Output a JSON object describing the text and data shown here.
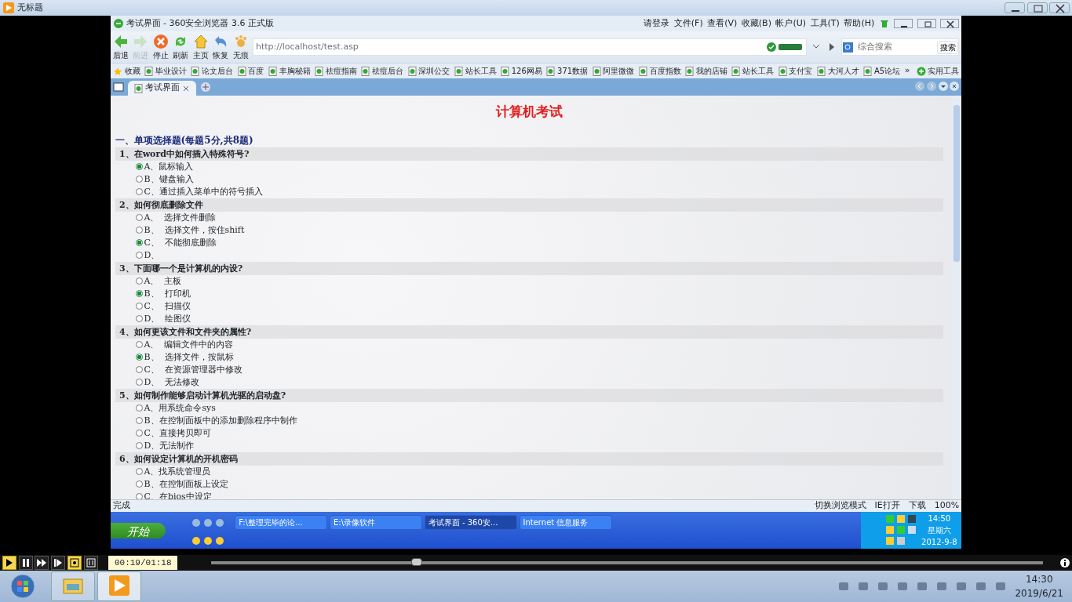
{
  "player_window": {
    "title": "无标题"
  },
  "browser": {
    "title": "考试界面 - 360安全浏览器 3.6 正式版",
    "menu": [
      "请登录",
      "文件(F)",
      "查看(V)",
      "收藏(B)",
      "帐户(U)",
      "工具(T)",
      "帮助(H)"
    ],
    "toolbar": [
      {
        "kind": "back",
        "label": "后退",
        "disabled": false
      },
      {
        "kind": "forward",
        "label": "前进",
        "disabled": true
      },
      {
        "kind": "stop",
        "label": "停止",
        "disabled": false
      },
      {
        "kind": "refresh",
        "label": "刷新",
        "disabled": false
      },
      {
        "kind": "home",
        "label": "主页",
        "disabled": false
      },
      {
        "kind": "restore",
        "label": "恢复",
        "disabled": false
      },
      {
        "kind": "private",
        "label": "无痕",
        "disabled": false
      }
    ],
    "address": "http://localhost/test.asp",
    "search": {
      "placeholder": "综合搜索",
      "button": "搜索"
    },
    "favorites": "收藏",
    "bookmarks": [
      "毕业设计",
      "论文后台",
      "百度",
      "丰胸秘籍",
      "祛痘指南",
      "祛痘后台",
      "深圳公交",
      "站长工具",
      "126网易",
      "371数据",
      "阿里微微",
      "百度指数",
      "我的店铺",
      "站长工具",
      "支付宝",
      "大河人才",
      "A5论坛"
    ],
    "more": "»",
    "tools": "实用工具",
    "tabs": [
      {
        "label": "考试界面",
        "selected": true
      }
    ]
  },
  "page": {
    "title": "计算机考试",
    "section": "一、单项选择题(每题5分,共8题)",
    "questions": [
      {
        "title": "1、在word中如何插入特殊符号?",
        "options": [
          {
            "text": "A、鼠标输入",
            "selected": true
          },
          {
            "text": "B、键盘输入",
            "selected": false
          },
          {
            "text": "C、通过插入菜单中的符号插入",
            "selected": false
          }
        ]
      },
      {
        "title": "2、如何彻底删除文件",
        "options": [
          {
            "text": "A、  选择文件删除",
            "selected": false
          },
          {
            "text": "B、  选择文件，按住shift",
            "selected": false
          },
          {
            "text": "C、  不能彻底删除",
            "selected": true
          },
          {
            "text": "D、",
            "selected": false
          }
        ]
      },
      {
        "title": "3、下面哪一个是计算机的内设?",
        "options": [
          {
            "text": "A、  主板",
            "selected": false
          },
          {
            "text": "B、  打印机",
            "selected": true
          },
          {
            "text": "C、  扫描仪",
            "selected": false
          },
          {
            "text": "D、  绘图仪",
            "selected": false
          }
        ]
      },
      {
        "title": "4、如何更该文件和文件夹的属性?",
        "options": [
          {
            "text": "A、  编辑文件中的内容",
            "selected": false
          },
          {
            "text": "B、  选择文件，按鼠标",
            "selected": true
          },
          {
            "text": "C、  在资源管理器中修改",
            "selected": false
          },
          {
            "text": "D、  无法修改",
            "selected": false
          }
        ]
      },
      {
        "title": "5、如何制作能够启动计算机光驱的启动盘?",
        "options": [
          {
            "text": "A、用系统命令sys",
            "selected": false
          },
          {
            "text": "B、在控制面板中的添加删除程序中制作",
            "selected": false
          },
          {
            "text": "C、直接拷贝即可",
            "selected": false
          },
          {
            "text": "D、无法制作",
            "selected": false
          }
        ]
      },
      {
        "title": "6、如何设定计算机的开机密码",
        "options": [
          {
            "text": "A、找系统管理员",
            "selected": false
          },
          {
            "text": "B、在控制面板上设定",
            "selected": false
          },
          {
            "text": "C、在bios中设定",
            "selected": false
          }
        ]
      }
    ]
  },
  "status_bar": {
    "text": "完成",
    "items": [
      "切换浏览模式",
      "IE打开",
      "下载",
      "100%"
    ]
  },
  "xp_taskbar": {
    "start": "开始",
    "tasks": [
      {
        "label": "F:\\整理完毕的论...",
        "selected": false
      },
      {
        "label": "E:\\录像软件",
        "selected": false
      },
      {
        "label": "考试界面 - 360安...",
        "selected": true
      },
      {
        "label": "Internet 信息服务",
        "selected": false
      }
    ],
    "time": "14:50",
    "day": "星期六",
    "date": "2012-9-8"
  },
  "player": {
    "time": "00:19/01:18",
    "level": 0.247
  },
  "taskbar": {
    "time": "14:30",
    "date": "2019/6/21"
  }
}
